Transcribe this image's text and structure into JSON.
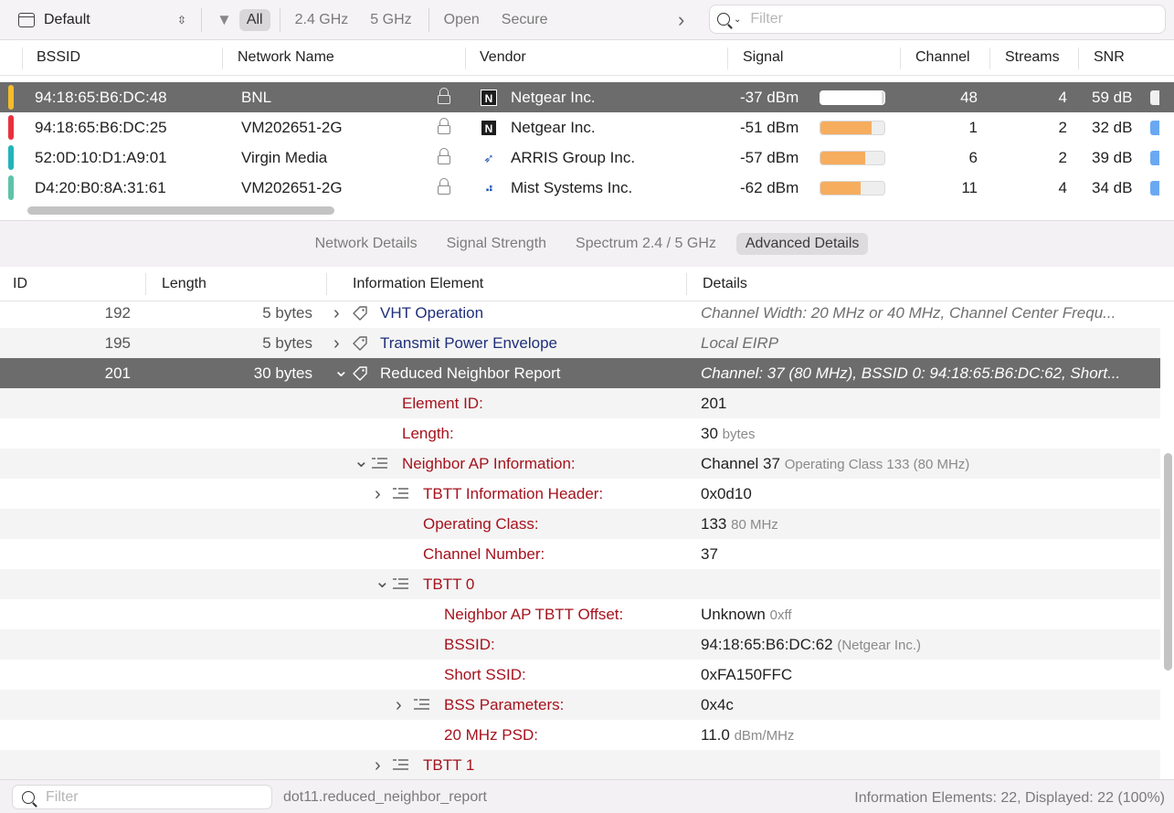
{
  "toolbar": {
    "preset_label": "Default",
    "filters": [
      "All",
      "2.4 GHz",
      "5 GHz",
      "Open",
      "Secure"
    ],
    "active_filter": "All",
    "search_placeholder": "Filter"
  },
  "networks": {
    "columns": [
      "BSSID",
      "Network Name",
      "Vendor",
      "Signal",
      "Channel",
      "Streams",
      "SNR"
    ],
    "rows": [
      {
        "bssid": "94:18:65:B6:DC:48",
        "name": "BNL",
        "vendor": "Netgear Inc.",
        "vendor_icon": "netgear-logo-icon",
        "signal": "-37 dBm",
        "signal_level": 0.95,
        "channel": "48",
        "streams": "4",
        "snr": "59 dB",
        "tag_color": "#f5bd2b",
        "selected": true
      },
      {
        "bssid": "94:18:65:B6:DC:25",
        "name": "VM202651-2G",
        "vendor": "Netgear Inc.",
        "vendor_icon": "netgear-logo-icon",
        "signal": "-51 dBm",
        "signal_level": 0.8,
        "channel": "1",
        "streams": "2",
        "snr": "32 dB",
        "tag_color": "#e8313c",
        "selected": false
      },
      {
        "bssid": "52:0D:10:D1:A9:01",
        "name": "Virgin Media",
        "vendor": "ARRIS Group Inc.",
        "vendor_icon": "arris-logo-icon",
        "signal": "-57 dBm",
        "signal_level": 0.7,
        "channel": "6",
        "streams": "2",
        "snr": "39 dB",
        "tag_color": "#23b3b8",
        "selected": false
      },
      {
        "bssid": "D4:20:B0:8A:31:61",
        "name": "VM202651-2G",
        "vendor": "Mist Systems Inc.",
        "vendor_icon": "mist-logo-icon",
        "signal": "-62 dBm",
        "signal_level": 0.63,
        "channel": "11",
        "streams": "4",
        "snr": "34 dB",
        "tag_color": "#5fc3a8",
        "selected": false
      }
    ]
  },
  "tabs": {
    "items": [
      "Network Details",
      "Signal Strength",
      "Spectrum 2.4 / 5 GHz",
      "Advanced Details"
    ],
    "active": "Advanced Details"
  },
  "ie_table": {
    "columns": [
      "ID",
      "Length",
      "Information Element",
      "Details"
    ],
    "rows": [
      {
        "kind": "ie",
        "id": "192",
        "length": "5 bytes",
        "label": "VHT Operation",
        "details": "Channel Width: 20 MHz or 40 MHz, Channel Center Frequ...",
        "expanded": false
      },
      {
        "kind": "ie",
        "id": "195",
        "length": "5 bytes",
        "label": "Transmit Power Envelope",
        "details": "Local EIRP",
        "expanded": false
      },
      {
        "kind": "ie",
        "id": "201",
        "length": "30 bytes",
        "label": "Reduced Neighbor Report",
        "details": "Channel: 37 (80 MHz), BSSID 0: 94:18:65:B6:DC:62, Short...",
        "expanded": true,
        "selected": true
      },
      {
        "kind": "field",
        "level": 1,
        "label": "Element ID:",
        "value": "201",
        "unit": ""
      },
      {
        "kind": "field",
        "level": 1,
        "label": "Length:",
        "value": "30",
        "unit": "bytes"
      },
      {
        "kind": "group",
        "level": 1,
        "label": "Neighbor AP Information:",
        "value": "Channel 37",
        "unit": "Operating Class 133 (80 MHz)",
        "expanded": true
      },
      {
        "kind": "group",
        "level": 2,
        "label": "TBTT Information Header:",
        "value": "0x0d10",
        "unit": "",
        "expanded": false
      },
      {
        "kind": "field",
        "level": 2,
        "label": "Operating Class:",
        "value": "133",
        "unit": "80 MHz"
      },
      {
        "kind": "field",
        "level": 2,
        "label": "Channel Number:",
        "value": "37",
        "unit": ""
      },
      {
        "kind": "group",
        "level": 2,
        "label": "TBTT 0",
        "value": "",
        "unit": "",
        "expanded": true
      },
      {
        "kind": "field",
        "level": 3,
        "label": "Neighbor AP TBTT Offset:",
        "value": "Unknown",
        "unit": "0xff"
      },
      {
        "kind": "field",
        "level": 3,
        "label": "BSSID:",
        "value": "94:18:65:B6:DC:62",
        "unit": "(Netgear Inc.)"
      },
      {
        "kind": "field",
        "level": 3,
        "label": "Short SSID:",
        "value": "0xFA150FFC",
        "unit": ""
      },
      {
        "kind": "group",
        "level": 3,
        "label": "BSS Parameters:",
        "value": "0x4c",
        "unit": "",
        "expanded": false
      },
      {
        "kind": "field",
        "level": 3,
        "label": "20 MHz PSD:",
        "value": "11.0",
        "unit": "dBm/MHz"
      },
      {
        "kind": "group",
        "level": 2,
        "label": "TBTT 1",
        "value": "",
        "unit": "",
        "expanded": false
      }
    ]
  },
  "status": {
    "search_placeholder": "Filter",
    "filter_expression": "dot11.reduced_neighbor_report",
    "summary": "Information Elements: 22, Displayed: 22 (100%)"
  }
}
